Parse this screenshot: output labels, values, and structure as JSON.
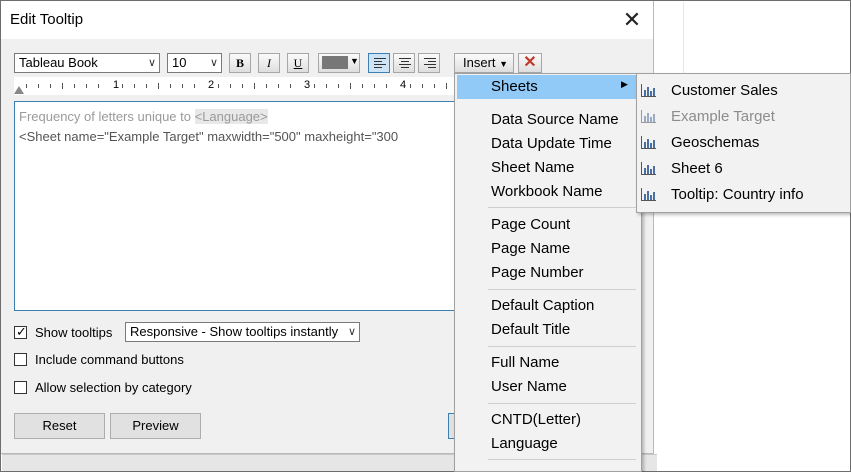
{
  "dialog": {
    "title": "Edit Tooltip",
    "close": "✕"
  },
  "toolbar": {
    "font": "Tableau Book",
    "size": "10",
    "bold": "B",
    "italic": "I",
    "underline": "U",
    "insert": "Insert",
    "clear": "✕"
  },
  "ruler": {
    "numbers": [
      "1",
      "2",
      "3",
      "4"
    ]
  },
  "editor": {
    "line1_text": "Frequency of letters unique to ",
    "line1_tag": "<Language>",
    "line2": "<Sheet name=\"Example Target\" maxwidth=\"500\" maxheight=\"300"
  },
  "options": {
    "show_tooltips": "Show tooltips",
    "show_tooltips_checked": true,
    "responsive": "Responsive - Show tooltips instantly",
    "include_command": "Include command buttons",
    "allow_selection": "Allow selection by category"
  },
  "buttons": {
    "reset": "Reset",
    "preview": "Preview"
  },
  "insert_menu": {
    "sheets": "Sheets",
    "data_source_name": "Data Source Name",
    "data_update_time": "Data Update Time",
    "sheet_name": "Sheet Name",
    "workbook_name": "Workbook Name",
    "page_count": "Page Count",
    "page_name": "Page Name",
    "page_number": "Page Number",
    "default_caption": "Default Caption",
    "default_title": "Default Title",
    "full_name": "Full Name",
    "user_name": "User Name",
    "cntd": "CNTD(Letter)",
    "language": "Language"
  },
  "sheets_menu": {
    "items": [
      "Customer Sales",
      "Example Target",
      "Geoschemas",
      "Sheet 6",
      "Tooltip: Country info"
    ],
    "icon": "bar-chart-icon"
  },
  "colors": {
    "highlight": "#91c9f7",
    "accent": "#3c7fb1",
    "disabled": "#8c8c8c"
  }
}
